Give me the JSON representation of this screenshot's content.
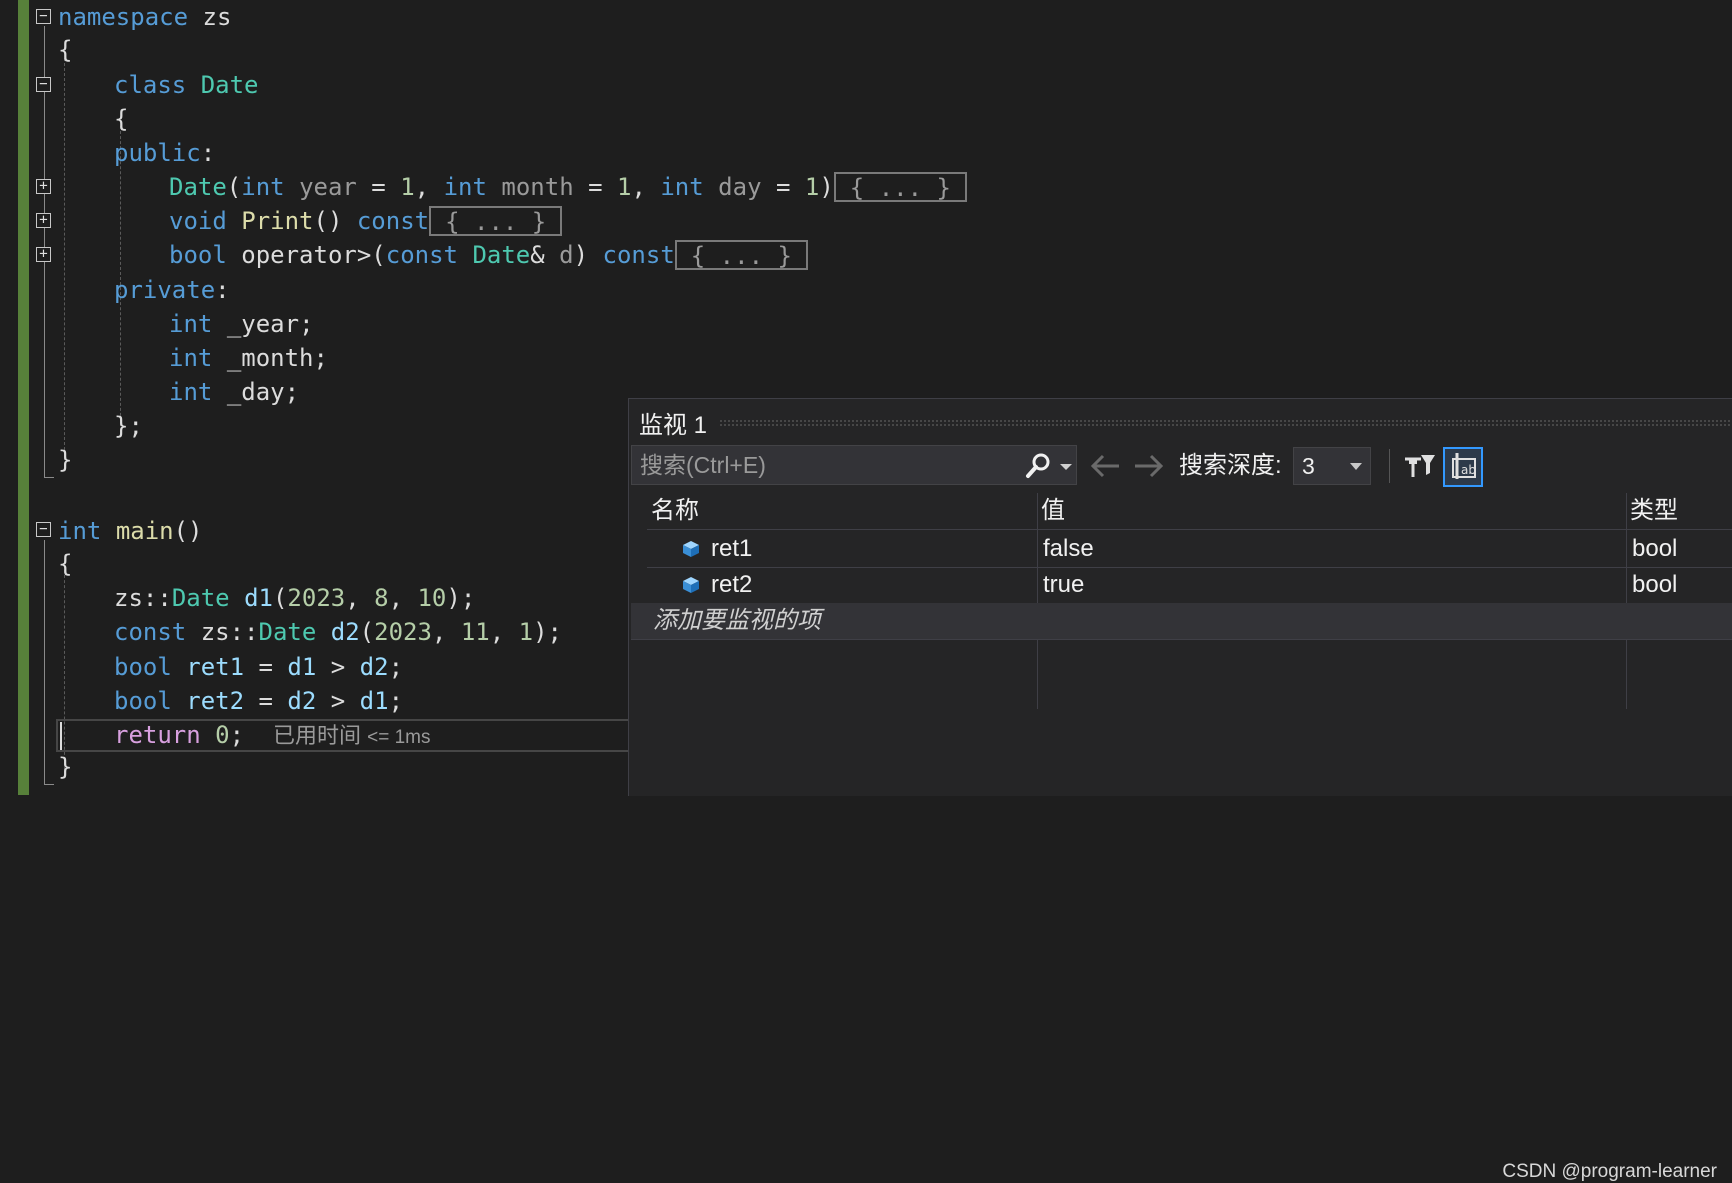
{
  "editor": {
    "lines": {
      "ns_kw": "namespace",
      "ns_name": "zs",
      "ob1": "{",
      "class_kw": "class",
      "class_name": "Date",
      "ob2": "{",
      "public_kw": "public",
      "colon": ":",
      "ctor_name": "Date",
      "ctor_p1": "(",
      "int1": "int",
      "year_p": "year",
      "eq1": " = ",
      "one1": "1",
      "c1": ", ",
      "int2": "int",
      "month_p": "month",
      "eq2": " = ",
      "one2": "1",
      "c2": ", ",
      "int3": "int",
      "day_p": "day",
      "eq3": " = ",
      "one3": "1",
      "ctor_p2": ")",
      "collapsed": "{ ... }",
      "void_kw": "void",
      "print_name": "Print",
      "print_paren": "()",
      "const1": "const",
      "bool_kw1": "bool",
      "op_name": "operator>",
      "op_p1": "(",
      "const2": "const",
      "date_ty2": "Date",
      "amp": "&",
      "d_param": "d",
      "op_p2": ")",
      "const3": "const",
      "private_kw": "private",
      "colon2": ":",
      "int4": "int",
      "year_m": "_year",
      "semi1": ";",
      "int5": "int",
      "month_m": "_month",
      "semi2": ";",
      "int6": "int",
      "day_m": "_day",
      "semi3": ";",
      "cb_semi": "};",
      "cb1": "}",
      "int_main": "int",
      "main_name": "main",
      "main_paren": "()",
      "ob3": "{",
      "zs1": "zs",
      "scope1": "::",
      "date_ty3": "Date",
      "d1": "d1",
      "args1": "(",
      "n2023a": "2023",
      "cm1": ", ",
      "n8": "8",
      "cm2": ", ",
      "n10": "10",
      "argsend1": ");",
      "const4": "const",
      "zs2": "zs",
      "scope2": "::",
      "date_ty4": "Date",
      "d2": "d2",
      "args2": "(",
      "n2023b": "2023",
      "cm3": ", ",
      "n11": "11",
      "cm4": ", ",
      "n1b": "1",
      "argsend2": ");",
      "bool_kw2": "bool",
      "ret1": "ret1",
      "eq4": " = ",
      "d1b": "d1",
      "gt1": " > ",
      "d2b": "d2",
      "semi4": ";",
      "bool_kw3": "bool",
      "ret2": "ret2",
      "eq5": " = ",
      "d2c": "d2",
      "gt2": " > ",
      "d1c": "d1",
      "semi5": ";",
      "return_kw": "return",
      "zero": "0",
      "semi6": ";",
      "elapsed_label": "已用时间",
      "elapsed_value": "<= 1ms",
      "cb2": "}"
    }
  },
  "watch": {
    "title": "监视 1",
    "search_placeholder": "搜索(Ctrl+E)",
    "depth_label": "搜索深度:",
    "depth_value": "3",
    "columns": {
      "name": "名称",
      "value": "值",
      "type": "类型"
    },
    "rows": [
      {
        "name": "ret1",
        "value": "false",
        "type": "bool"
      },
      {
        "name": "ret2",
        "value": "true",
        "type": "bool"
      }
    ],
    "add_item": "添加要监视的项"
  },
  "watermark": "CSDN @program-learner",
  "colors": {
    "keyword": "#569cd6",
    "type": "#4ec9b0",
    "function": "#dcdcaa",
    "number": "#b5cea8",
    "control": "#d8a0df",
    "accent": "#3399ff"
  }
}
